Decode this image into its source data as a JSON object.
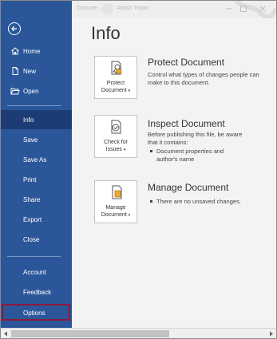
{
  "titlebar": {
    "doc_name": "Docume...",
    "user_name": "Akash Tiwari"
  },
  "sidebar": {
    "items": [
      {
        "label": "Home"
      },
      {
        "label": "New"
      },
      {
        "label": "Open"
      },
      {
        "label": "Info"
      },
      {
        "label": "Save"
      },
      {
        "label": "Save As"
      },
      {
        "label": "Print"
      },
      {
        "label": "Share"
      },
      {
        "label": "Export"
      },
      {
        "label": "Close"
      },
      {
        "label": "Account"
      },
      {
        "label": "Feedback"
      },
      {
        "label": "Options"
      }
    ],
    "active": "Info",
    "highlighted": "Options",
    "bg_color": "#2b579a",
    "active_color": "#1b3c74",
    "highlight_border": "#8b1a3e"
  },
  "main": {
    "title": "Info",
    "sections": [
      {
        "tile_line1": "Protect",
        "tile_line2": "Document",
        "title": "Protect Document",
        "text": "Control what types of changes people can make to this document.",
        "icon": "lock-document-icon"
      },
      {
        "tile_line1": "Check for",
        "tile_line2": "Issues",
        "title": "Inspect Document",
        "text": "Before publishing this file, be aware that it contains:",
        "bullets": [
          "Document properties and author's name"
        ],
        "icon": "check-issues-icon"
      },
      {
        "tile_line1": "Manage",
        "tile_line2": "Document",
        "title": "Manage Document",
        "bullets": [
          "There are no unsaved changes."
        ],
        "icon": "manage-document-icon"
      }
    ]
  }
}
